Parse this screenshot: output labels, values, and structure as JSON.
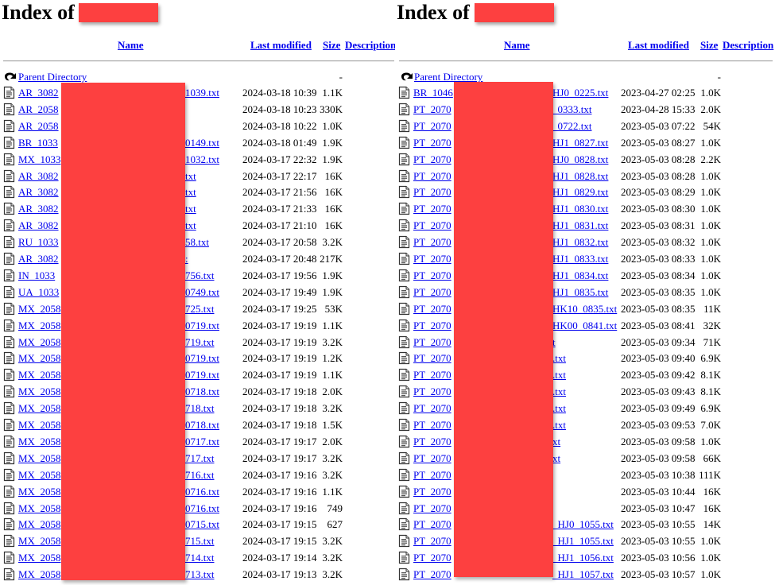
{
  "panels": [
    {
      "title": "Index of",
      "title_redacted": true,
      "columns": {
        "name": "Name",
        "last_modified": "Last modified",
        "size": "Size",
        "description": "Description"
      },
      "parent": {
        "label": "Parent Directory",
        "size": "-"
      },
      "rows": [
        {
          "prefix": "AR_3082",
          "suffix": "1039.txt",
          "modified": "2024-03-18 10:39",
          "size": "1.1K"
        },
        {
          "prefix": "AR_2058",
          "suffix": "",
          "modified": "2024-03-18 10:23",
          "size": "330K"
        },
        {
          "prefix": "AR_2058",
          "suffix": "",
          "modified": "2024-03-18 10:22",
          "size": "1.0K"
        },
        {
          "prefix": "BR_1033",
          "suffix": "0149.txt",
          "modified": "2024-03-18 01:49",
          "size": "1.9K"
        },
        {
          "prefix": "MX_1033",
          "suffix": "1032.txt",
          "modified": "2024-03-17 22:32",
          "size": "1.9K"
        },
        {
          "prefix": "AR_3082",
          "suffix": "txt",
          "modified": "2024-03-17 22:17",
          "size": "16K"
        },
        {
          "prefix": "AR_3082",
          "suffix": "txt",
          "modified": "2024-03-17 21:56",
          "size": "16K"
        },
        {
          "prefix": "AR_3082",
          "suffix": "txt",
          "modified": "2024-03-17 21:33",
          "size": "16K"
        },
        {
          "prefix": "AR_3082",
          "suffix": "txt",
          "modified": "2024-03-17 21:10",
          "size": "16K"
        },
        {
          "prefix": "RU_1033",
          "suffix": "58.txt",
          "modified": "2024-03-17 20:58",
          "size": "3.2K"
        },
        {
          "prefix": "AR_3082",
          "suffix": ":",
          "modified": "2024-03-17 20:48",
          "size": "217K"
        },
        {
          "prefix": "IN_1033",
          "suffix": "756.txt",
          "modified": "2024-03-17 19:56",
          "size": "1.9K"
        },
        {
          "prefix": "UA_1033",
          "suffix": "0749.txt",
          "modified": "2024-03-17 19:49",
          "size": "1.9K"
        },
        {
          "prefix": "MX_2058",
          "suffix": "725.txt",
          "modified": "2024-03-17 19:25",
          "size": "53K"
        },
        {
          "prefix": "MX_2058",
          "suffix": "0719.txt",
          "modified": "2024-03-17 19:19",
          "size": "1.1K"
        },
        {
          "prefix": "MX_2058",
          "suffix": "719.txt",
          "modified": "2024-03-17 19:19",
          "size": "3.2K"
        },
        {
          "prefix": "MX_2058",
          "suffix": "0719.txt",
          "modified": "2024-03-17 19:19",
          "size": "1.2K"
        },
        {
          "prefix": "MX_2058",
          "suffix": "0719.txt",
          "modified": "2024-03-17 19:19",
          "size": "1.1K"
        },
        {
          "prefix": "MX_2058",
          "suffix": "0718.txt",
          "modified": "2024-03-17 19:18",
          "size": "2.0K"
        },
        {
          "prefix": "MX_2058",
          "suffix": "718.txt",
          "modified": "2024-03-17 19:18",
          "size": "3.2K"
        },
        {
          "prefix": "MX_2058",
          "suffix": "0718.txt",
          "modified": "2024-03-17 19:18",
          "size": "1.5K"
        },
        {
          "prefix": "MX_2058",
          "suffix": "0717.txt",
          "modified": "2024-03-17 19:17",
          "size": "2.0K"
        },
        {
          "prefix": "MX_2058",
          "suffix": "717.txt",
          "modified": "2024-03-17 19:17",
          "size": "3.2K"
        },
        {
          "prefix": "MX_2058",
          "suffix": "716.txt",
          "modified": "2024-03-17 19:16",
          "size": "3.2K"
        },
        {
          "prefix": "MX_2058",
          "suffix": "0716.txt",
          "modified": "2024-03-17 19:16",
          "size": "1.1K"
        },
        {
          "prefix": "MX_2058",
          "suffix": "0716.txt",
          "modified": "2024-03-17 19:16",
          "size": "749"
        },
        {
          "prefix": "MX_2058",
          "suffix": "0715.txt",
          "modified": "2024-03-17 19:15",
          "size": "627"
        },
        {
          "prefix": "MX_2058",
          "suffix": "715.txt",
          "modified": "2024-03-17 19:15",
          "size": "3.2K"
        },
        {
          "prefix": "MX_2058",
          "suffix": "714.txt",
          "modified": "2024-03-17 19:14",
          "size": "3.2K"
        },
        {
          "prefix": "MX_2058",
          "suffix": "713.txt",
          "modified": "2024-03-17 19:13",
          "size": "3.2K"
        }
      ]
    },
    {
      "title": "Index of",
      "title_redacted": true,
      "columns": {
        "name": "Name",
        "last_modified": "Last modified",
        "size": "Size",
        "description": "Description"
      },
      "parent": {
        "label": "Parent Directory",
        "size": "-"
      },
      "rows": [
        {
          "prefix": "BR_1046",
          "suffix": "HJ0_0225.txt",
          "modified": "2023-04-27 02:25",
          "size": "1.0K"
        },
        {
          "prefix": "PT_2070",
          "suffix": "_0333.txt",
          "modified": "2023-04-28 15:33",
          "size": "2.0K"
        },
        {
          "prefix": "PT_2070",
          "suffix": "_0722.txt",
          "modified": "2023-05-03 07:22",
          "size": "54K"
        },
        {
          "prefix": "PT_2070",
          "suffix": "HJ1_0827.txt",
          "modified": "2023-05-03 08:27",
          "size": "1.0K"
        },
        {
          "prefix": "PT_2070",
          "suffix": "HJ0_0828.txt",
          "modified": "2023-05-03 08:28",
          "size": "2.2K"
        },
        {
          "prefix": "PT_2070",
          "suffix": "HJ1_0828.txt",
          "modified": "2023-05-03 08:28",
          "size": "1.0K"
        },
        {
          "prefix": "PT_2070",
          "suffix": "HJ1_0829.txt",
          "modified": "2023-05-03 08:29",
          "size": "1.0K"
        },
        {
          "prefix": "PT_2070",
          "suffix": "HJ1_0830.txt",
          "modified": "2023-05-03 08:30",
          "size": "1.0K"
        },
        {
          "prefix": "PT_2070",
          "suffix": "HJ1_0831.txt",
          "modified": "2023-05-03 08:31",
          "size": "1.0K"
        },
        {
          "prefix": "PT_2070",
          "suffix": "HJ1_0832.txt",
          "modified": "2023-05-03 08:32",
          "size": "1.0K"
        },
        {
          "prefix": "PT_2070",
          "suffix": "HJ1_0833.txt",
          "modified": "2023-05-03 08:33",
          "size": "1.0K"
        },
        {
          "prefix": "PT_2070",
          "suffix": "HJ1_0834.txt",
          "modified": "2023-05-03 08:34",
          "size": "1.0K"
        },
        {
          "prefix": "PT_2070",
          "suffix": "HJ1_0835.txt",
          "modified": "2023-05-03 08:35",
          "size": "1.0K"
        },
        {
          "prefix": "PT_2070",
          "suffix": "HK10_0835.txt",
          "modified": "2023-05-03 08:35",
          "size": "11K"
        },
        {
          "prefix": "PT_2070",
          "suffix": "HK00_0841.txt",
          "modified": "2023-05-03 08:41",
          "size": "32K"
        },
        {
          "prefix": "PT_2070",
          "suffix": "t",
          "modified": "2023-05-03 09:34",
          "size": "71K"
        },
        {
          "prefix": "PT_2070",
          "suffix": ".txt",
          "modified": "2023-05-03 09:40",
          "size": "6.9K"
        },
        {
          "prefix": "PT_2070",
          "suffix": ".txt",
          "modified": "2023-05-03 09:42",
          "size": "8.1K"
        },
        {
          "prefix": "PT_2070",
          "suffix": ".txt",
          "modified": "2023-05-03 09:43",
          "size": "8.1K"
        },
        {
          "prefix": "PT_2070",
          "suffix": ".txt",
          "modified": "2023-05-03 09:49",
          "size": "6.9K"
        },
        {
          "prefix": "PT_2070",
          "suffix": ".txt",
          "modified": "2023-05-03 09:53",
          "size": "7.0K"
        },
        {
          "prefix": "PT_2070",
          "suffix": "xt",
          "modified": "2023-05-03 09:58",
          "size": "1.0K"
        },
        {
          "prefix": "PT_2070",
          "suffix": "xt",
          "modified": "2023-05-03 09:58",
          "size": "66K"
        },
        {
          "prefix": "PT_2070",
          "suffix": "",
          "modified": "2023-05-03 10:38",
          "size": "111K"
        },
        {
          "prefix": "PT_2070",
          "suffix": "",
          "modified": "2023-05-03 10:44",
          "size": "16K"
        },
        {
          "prefix": "PT_2070",
          "suffix": "",
          "modified": "2023-05-03 10:47",
          "size": "16K"
        },
        {
          "prefix": "PT_2070",
          "suffix": "_HJ0_1055.txt",
          "modified": "2023-05-03 10:55",
          "size": "14K"
        },
        {
          "prefix": "PT_2070",
          "suffix": "_HJ1_1055.txt",
          "modified": "2023-05-03 10:55",
          "size": "1.0K"
        },
        {
          "prefix": "PT_2070",
          "suffix": "_HJ1_1056.txt",
          "modified": "2023-05-03 10:56",
          "size": "1.0K"
        },
        {
          "prefix": "PT_2070",
          "suffix": "_HJ1_1057.txt",
          "modified": "2023-05-03 10:57",
          "size": "1.0K"
        }
      ]
    }
  ],
  "icons": {
    "parent": "back-arrow-icon",
    "file": "text-file-icon"
  },
  "colors": {
    "link": "#0000ee",
    "redaction": "#fd4040",
    "rule": "#a9a9a9"
  }
}
